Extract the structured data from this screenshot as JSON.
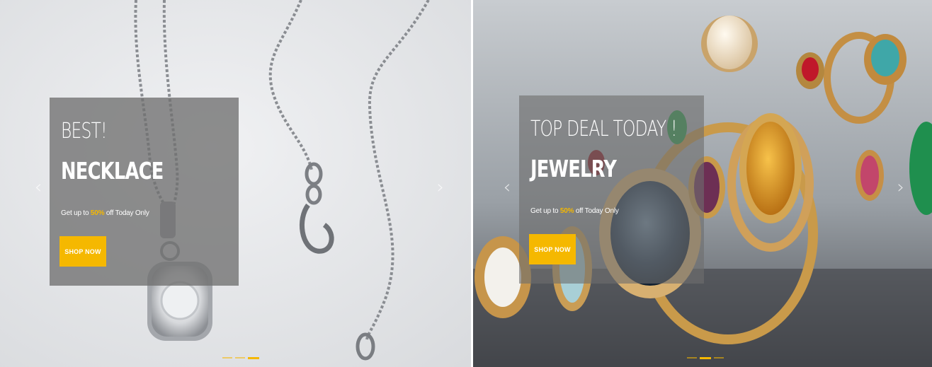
{
  "slides": [
    {
      "line1": "BEST!",
      "line2": "NECKLACE",
      "sub_prefix": "Get up to ",
      "sub_highlight": "50%",
      "sub_suffix": " off Today Only",
      "button_label": "SHOP NOW",
      "prev_arrow": "‹",
      "next_arrow": "›",
      "active_dot": 3,
      "dot_count": 3
    },
    {
      "line1": "TOP DEAL TODAY !",
      "line2": "JEWELRY",
      "sub_prefix": "Get up to ",
      "sub_highlight": "50%",
      "sub_suffix": " off Today Only",
      "button_label": "SHOP NOW",
      "prev_arrow": "‹",
      "next_arrow": "›",
      "active_dot": 2,
      "dot_count": 3
    }
  ],
  "colors": {
    "accent": "#f5b800",
    "caption_bg": "#707070"
  },
  "icons": {
    "prev": "chevron-left-icon",
    "next": "chevron-right-icon"
  }
}
